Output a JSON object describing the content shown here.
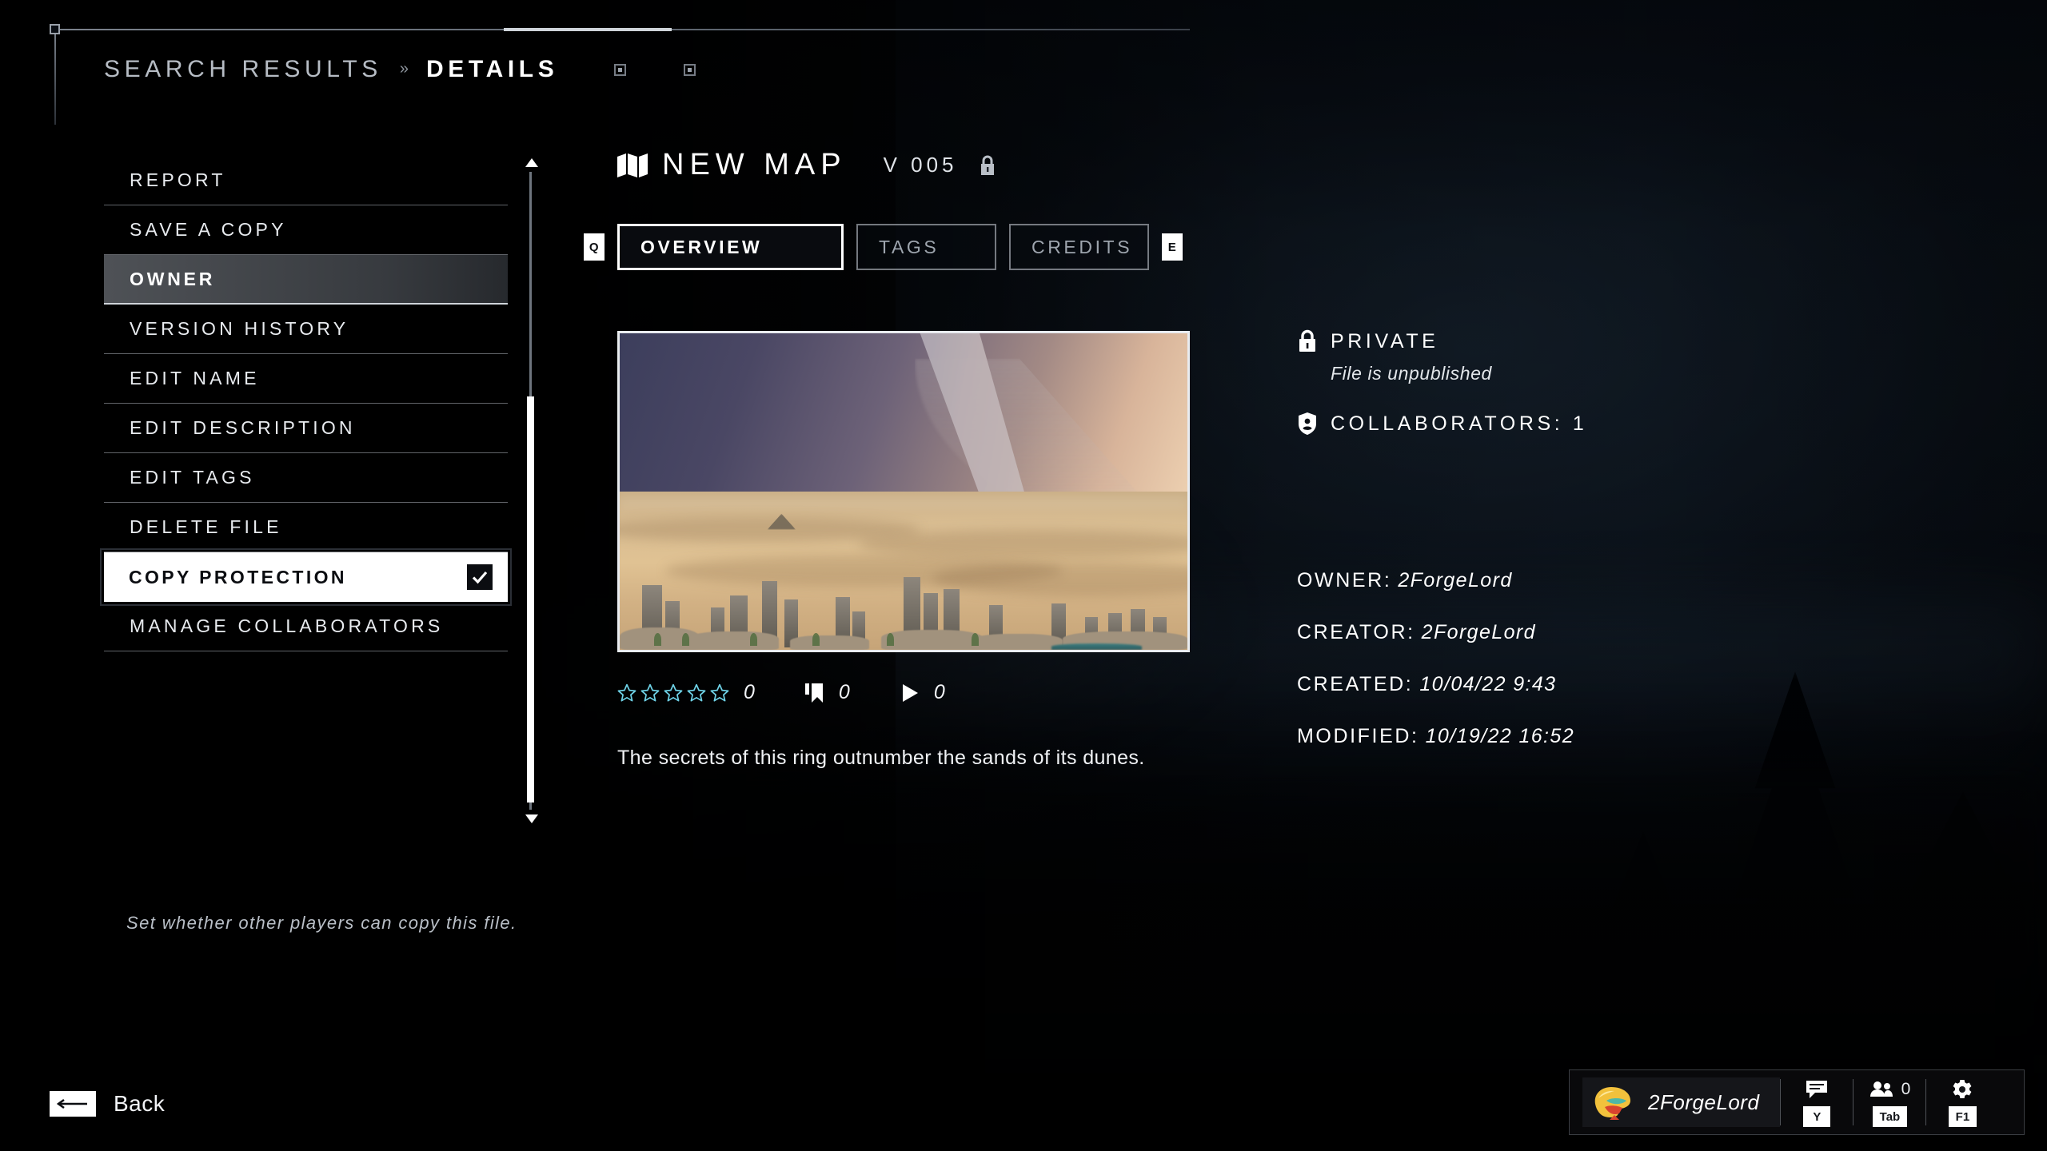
{
  "header": {
    "breadcrumb_parent": "SEARCH RESULTS",
    "breadcrumb_separator": "»",
    "breadcrumb_current": "DETAILS"
  },
  "sidebar": {
    "items": [
      {
        "label": "REPORT",
        "state": "normal"
      },
      {
        "label": "SAVE A COPY",
        "state": "normal"
      },
      {
        "label": "OWNER",
        "state": "hover"
      },
      {
        "label": "VERSION HISTORY",
        "state": "normal"
      },
      {
        "label": "EDIT NAME",
        "state": "normal"
      },
      {
        "label": "EDIT DESCRIPTION",
        "state": "normal"
      },
      {
        "label": "EDIT TAGS",
        "state": "normal"
      },
      {
        "label": "DELETE FILE",
        "state": "normal"
      },
      {
        "label": "COPY PROTECTION",
        "state": "selected",
        "checked": true
      },
      {
        "label": "MANAGE COLLABORATORS",
        "state": "normal"
      }
    ],
    "hint": "Set whether other players can copy this file."
  },
  "detail": {
    "map_name": "NEW MAP",
    "version_label": "V  005",
    "tab_prev_key": "Q",
    "tab_next_key": "E",
    "tabs": [
      {
        "label": "OVERVIEW",
        "active": true
      },
      {
        "label": "TAGS",
        "active": false
      },
      {
        "label": "CREDITS",
        "active": false
      }
    ],
    "stats": {
      "rating_count": "0",
      "bookmark_count": "0",
      "play_count": "0",
      "stars_filled": 0,
      "stars_total": 5
    },
    "description": "The secrets of this ring outnumber the sands of its dunes."
  },
  "info": {
    "visibility": "PRIVATE",
    "publish_status": "File is unpublished",
    "collaborators": "COLLABORATORS: 1",
    "meta": [
      {
        "label": "OWNER:",
        "value": "2ForgeLord"
      },
      {
        "label": "CREATOR:",
        "value": "2ForgeLord"
      },
      {
        "label": "CREATED:",
        "value": "10/04/22 9:43"
      },
      {
        "label": "MODIFIED:",
        "value": "10/19/22 16:52"
      }
    ]
  },
  "footer": {
    "back_label": "Back",
    "player_name": "2ForgeLord",
    "chat_key": "Y",
    "roster_count": "0",
    "roster_key": "Tab",
    "settings_key": "F1"
  },
  "colors": {
    "accent_star": "#6fd3e8",
    "text_primary": "#ffffff",
    "text_muted": "#9ea5ae",
    "selected_bg": "#ffffff",
    "panel_bg": "#05070b"
  }
}
